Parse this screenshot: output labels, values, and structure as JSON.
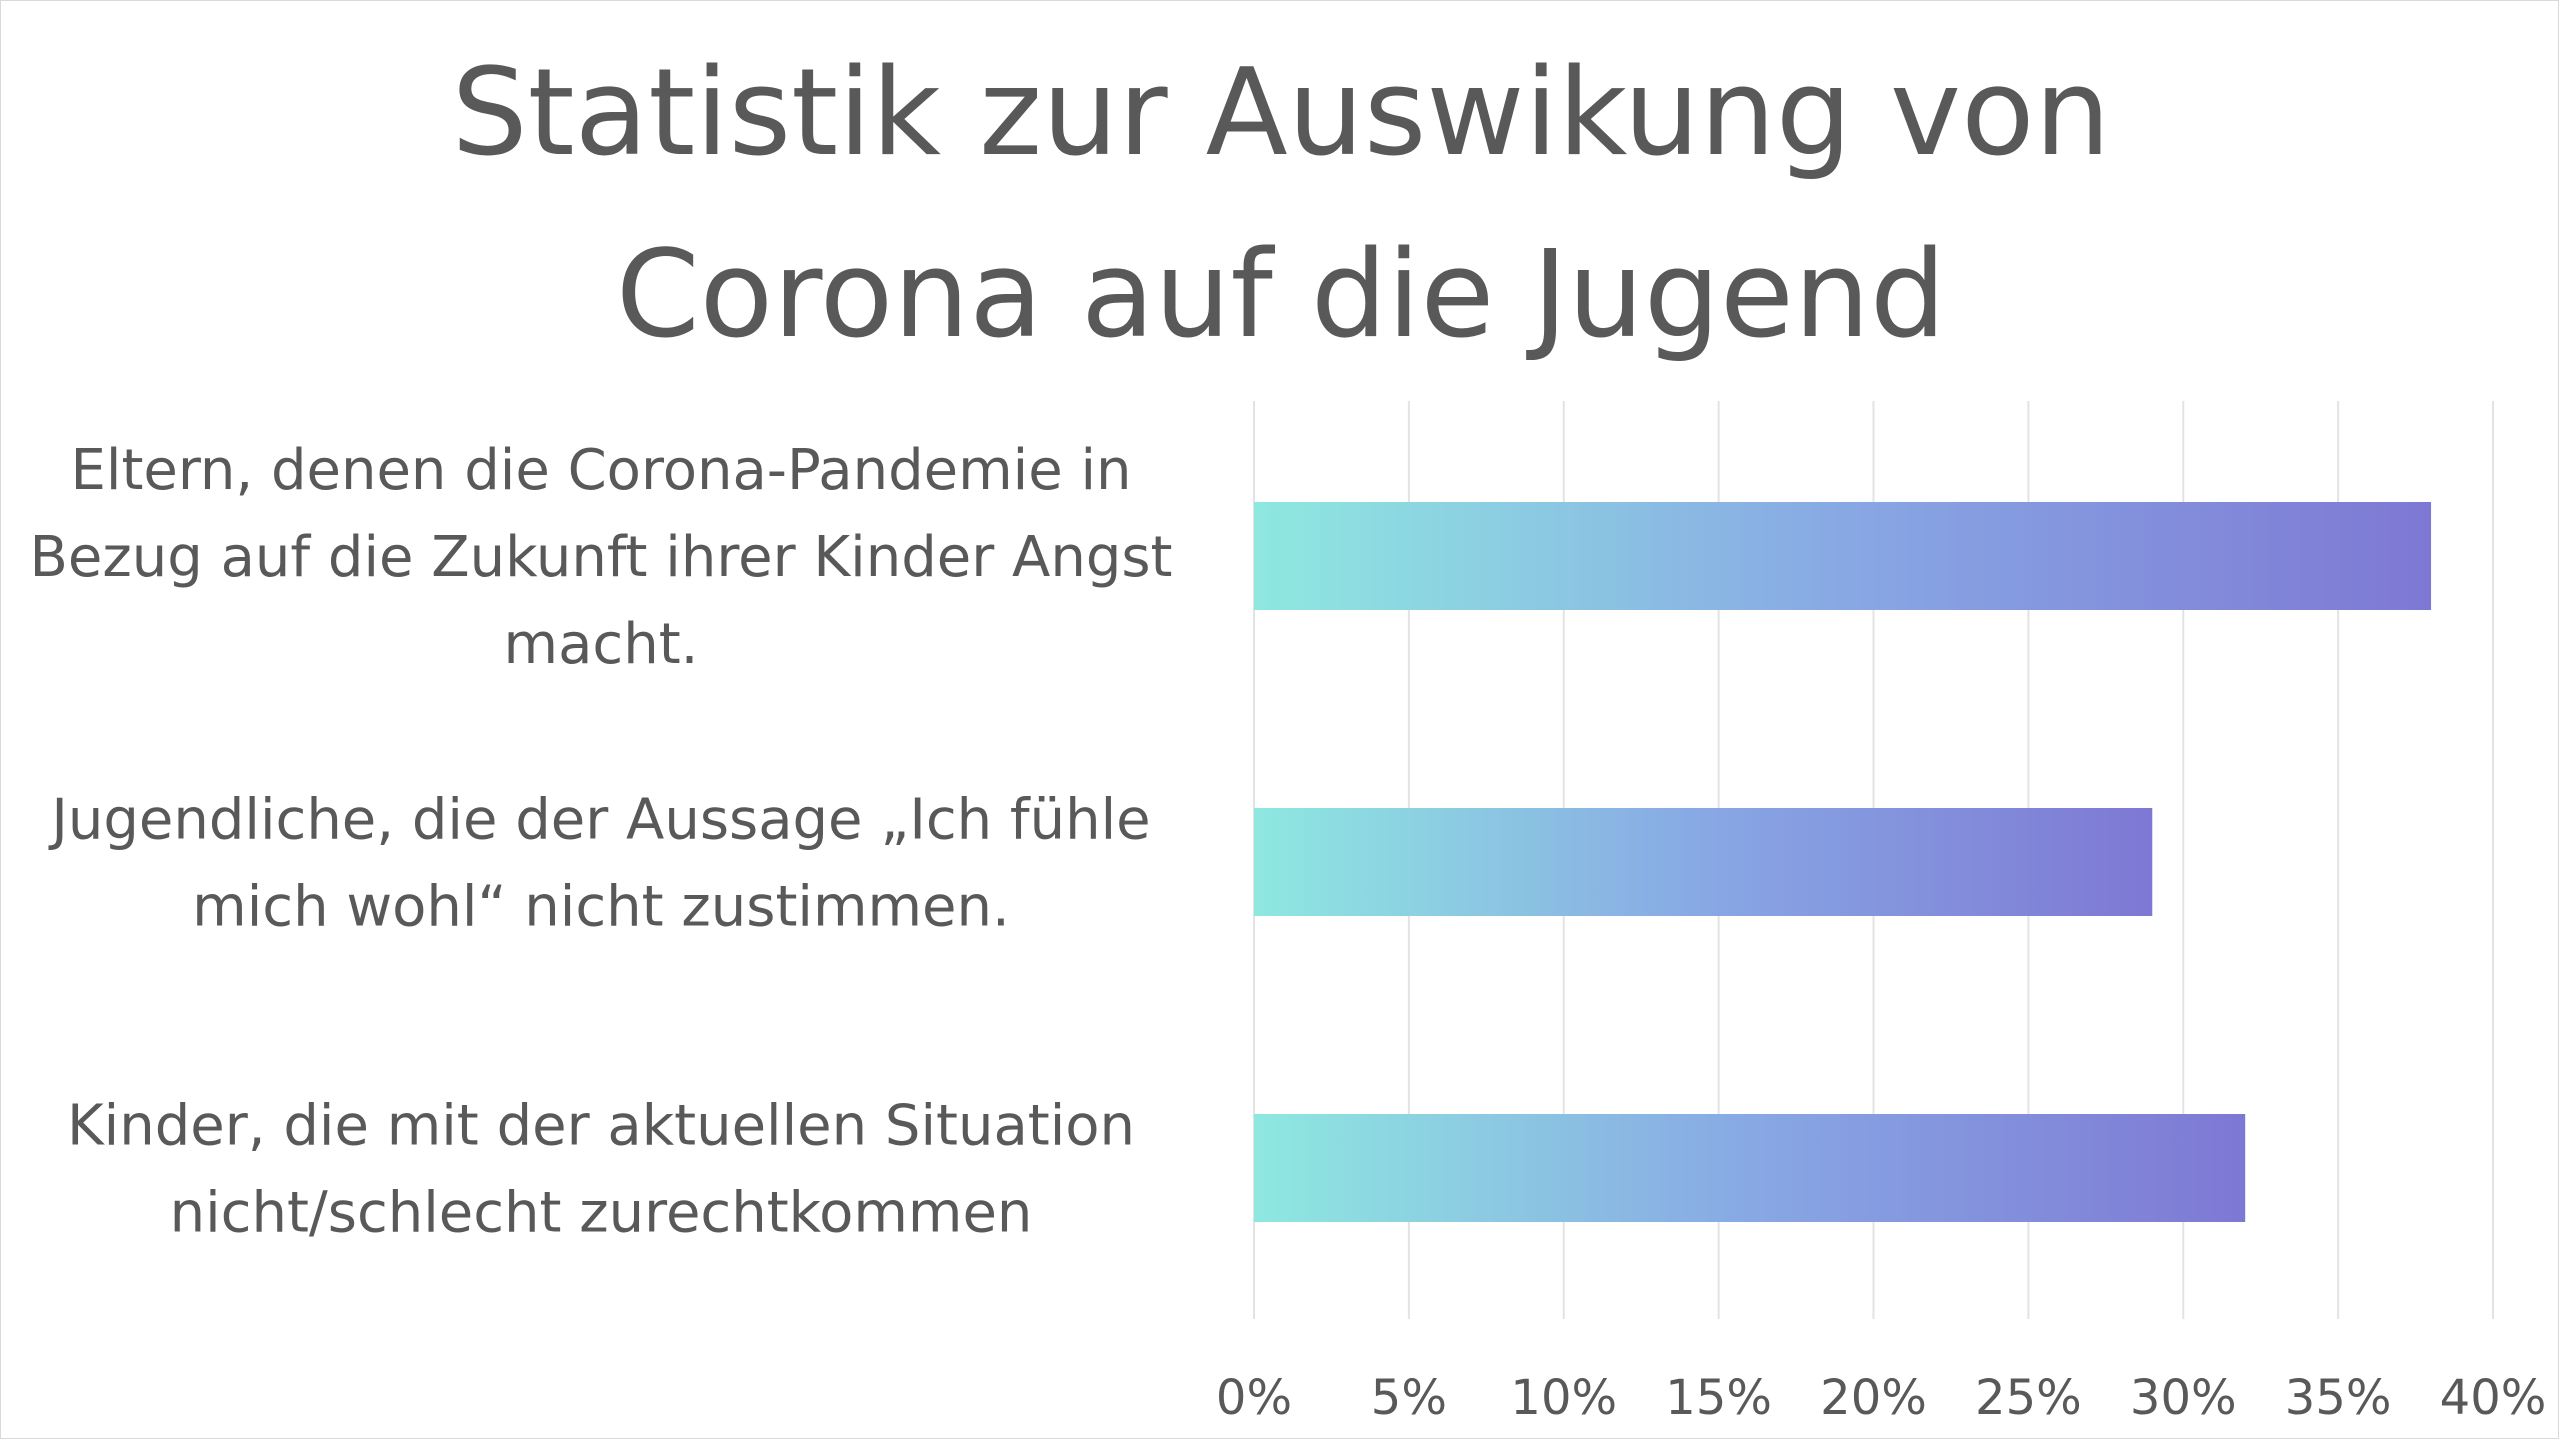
{
  "chart_data": {
    "type": "bar",
    "orientation": "horizontal",
    "title_lines": [
      "Statistik zur Auswikung von",
      "Corona auf die Jugend"
    ],
    "categories": [
      [
        "Eltern, denen die Corona-Pandemie in",
        "Bezug auf die Zukunft ihrer Kinder Angst",
        "macht."
      ],
      [
        "Jugendliche, die der Aussage „Ich fühle",
        "mich wohl“ nicht zustimmen."
      ],
      [
        "Kinder, die mit der aktuellen Situation",
        "nicht/schlecht zurechtkommen"
      ]
    ],
    "values": [
      38,
      29,
      32
    ],
    "value_unit": "%",
    "xlim": [
      0,
      40
    ],
    "xticks": [
      0,
      5,
      10,
      15,
      20,
      25,
      30,
      35,
      40
    ],
    "xtick_labels": [
      "0%",
      "5%",
      "10%",
      "15%",
      "20%",
      "25%",
      "30%",
      "35%",
      "40%"
    ],
    "grid": "vertical",
    "legend": "none",
    "colors": {
      "bar_start": "#8ee8e0",
      "bar_mid": "#88a8e4",
      "bar_end": "#7e78d4",
      "text": "#595959",
      "grid": "#e3e3e3",
      "border": "#d9d9d9"
    }
  }
}
